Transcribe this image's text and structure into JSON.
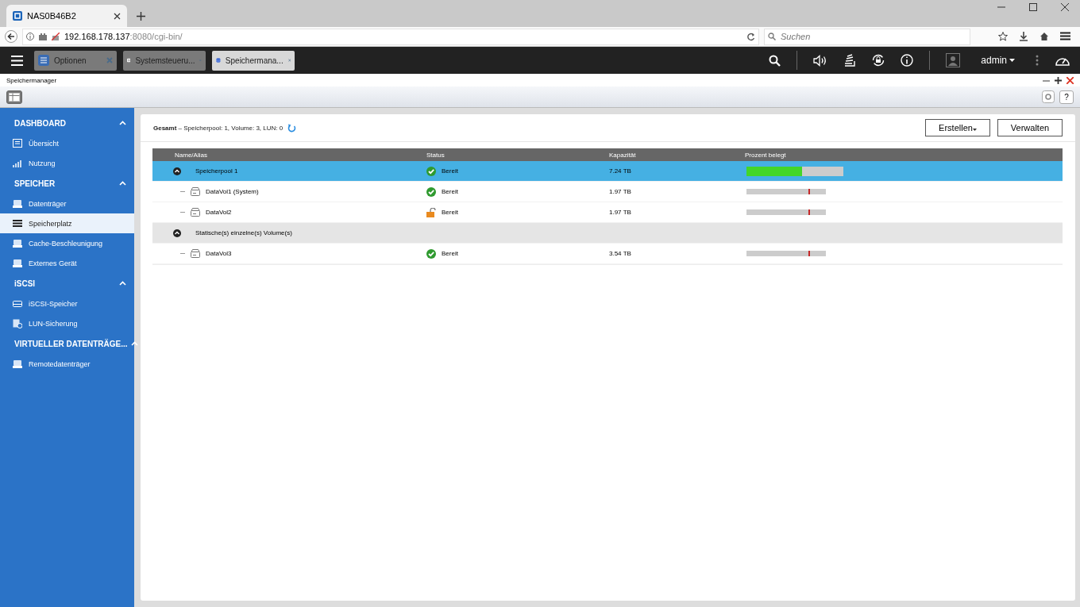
{
  "browser": {
    "tabs": [
      {
        "title": "NAS0B46B2",
        "selected": true
      }
    ],
    "url_host": "192.168.178.137",
    "url_rest": ":8080/cgi-bin/",
    "search_placeholder": "Suchen"
  },
  "nas_bar": {
    "apps": [
      {
        "label": "Optionen",
        "selected": false
      },
      {
        "label": "Systemsteueru...",
        "selected": false
      },
      {
        "label": "Speichermana...",
        "selected": true
      }
    ],
    "user": "admin"
  },
  "app": {
    "title": "Speichermanager",
    "help": "?"
  },
  "sidebar": {
    "sections": [
      {
        "title": "DASHBOARD",
        "expanded": true,
        "items": [
          {
            "label": "Übersicht",
            "selected": false
          },
          {
            "label": "Nutzung",
            "selected": false
          }
        ]
      },
      {
        "title": "SPEICHER",
        "expanded": true,
        "items": [
          {
            "label": "Datenträger",
            "selected": false
          },
          {
            "label": "Speicherplatz",
            "selected": true
          },
          {
            "label": "Cache-Beschleunigung",
            "selected": false
          },
          {
            "label": "Externes Gerät",
            "selected": false
          }
        ]
      },
      {
        "title": "iSCSI",
        "expanded": true,
        "items": [
          {
            "label": "iSCSI-Speicher",
            "selected": false
          },
          {
            "label": "LUN-Sicherung",
            "selected": false
          }
        ]
      },
      {
        "title": "VIRTUELLER DATENTRÄGE...",
        "expanded": true,
        "items": [
          {
            "label": "Remotedatenträger",
            "selected": false
          }
        ]
      }
    ]
  },
  "summary": {
    "label": "Gesamt",
    "text": "– Speicherpool: 1, Volume: 3, LUN: 0"
  },
  "buttons": [
    {
      "label": "Erstellen",
      "dropdown": true
    },
    {
      "label": "Verwalten",
      "dropdown": false
    }
  ],
  "table": {
    "columns": [
      "Name/Alias",
      "Status",
      "Kapazität",
      "Prozent belegt"
    ],
    "rows": [
      {
        "kind": "pool",
        "name": "Speicherpool 1",
        "expanded": true,
        "selected": true,
        "status": {
          "text": "Bereit",
          "kind": "ok"
        },
        "capacity": "7.24 TB",
        "level": 0.57,
        "children": [
          {
            "kind": "volume",
            "name": "DataVol1 (System)",
            "selected": false,
            "status": {
              "text": "Bereit",
              "kind": "ok"
            },
            "capacity": "1.97 TB"
          },
          {
            "kind": "volume",
            "name": "DataVol2",
            "selected": false,
            "status": {
              "text": "Bereit",
              "kind": "unlocked"
            },
            "capacity": "1.97 TB"
          }
        ]
      },
      {
        "kind": "group",
        "name": "Statische(s) einzelne(s) Volume(s)",
        "expanded": true,
        "selected": false,
        "children": [
          {
            "kind": "volume",
            "name": "DataVol3",
            "selected": false,
            "status": {
              "text": "Bereit",
              "kind": "ok"
            },
            "capacity": "3.54 TB"
          }
        ]
      }
    ]
  }
}
